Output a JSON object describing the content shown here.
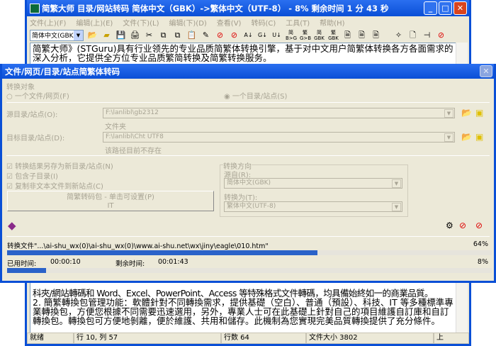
{
  "main": {
    "title": "简繁大师 目录/网站转码 简体中文（GBK）->繁体中文（UTF-8） - 8% 剩余时间 1 分 43 秒",
    "menu": [
      "文件(上)(F)",
      "编辑(上)(E)",
      "文件(下)(L)",
      "编辑(下)(D)",
      "查看(V)",
      "转码(C)",
      "工具(T)",
      "帮助(H)"
    ],
    "encoding_select": "简体中文(GBK)",
    "toolbar_labels": [
      "简B>G",
      "繁G>B",
      "简GBK",
      "繁GBK"
    ],
    "text_top": "简繁大师》(STGuru)具有行业领先的专业品质简繁体转换引擎，基于对中文用户简繁体转换各方各面需求的深入分析，它提供全方位专业品质繁简转换及简繁转换服务。",
    "text_bottom": [
      "科夾/網站轉碼和 Word、Excel、PowerPoint、Access 等特殊格式文件轉碼，均具備始終如一的商業品質。",
      "2. 簡繁轉換包管理功能：軟體針對不同轉換需求，提供基礎（空白）、普通（預設）、科技、IT 等多種標準專業轉換包，方便您根據不同需要迅速選用，另外，專業人士可在此基礎上針對自己的項目維護自訂庫和自訂轉換包。轉換包可方便地剝離，便於維護、共用和儲存。此機制為您實現完美品質轉換提供了充分條件。"
    ],
    "status": {
      "state": "就绪",
      "position": "行 10, 列 57",
      "lines": "行数 64",
      "size": "文件大小 3802",
      "dir": "上"
    }
  },
  "dialog": {
    "title": "文件/网页/目录/站点简繁体转码",
    "target_label": "转换对象",
    "radio_file": "一个文件/网页(F)",
    "radio_dir": "一个目录/站点(S)",
    "source_label": "源目录/站点(O):",
    "source_value": "F:\\lanlibl\\gb2312",
    "source_hint": "文件夹",
    "dest_label": "目标目录/站点(D):",
    "dest_value": "F:\\lanlibl\\Cht UTF8",
    "dest_hint": "该路径目前不存在",
    "checks": [
      "转换结果另存为新目录/站点(N)",
      "包含子目录(I)",
      "复制非文本文件到新站点(C)"
    ],
    "package_button": "简繁转码包 - 单击可设置(P)",
    "package_name": "IT",
    "direction_group": "转换方向",
    "src_enc_label": "源自(R):",
    "src_enc": "简体中文(GBK)",
    "dst_enc_label": "转换为(T):",
    "dst_enc": "繁体中文(UTF-8)",
    "file_progress_text": "转换文件\"...\\ai-shu_wx(0)\\ai-shu_wx(0)\\www.ai-shu.net\\wx\\jiny\\eagle\\010.htm\"",
    "file_progress_pct": "64%",
    "file_progress": 64,
    "elapsed_label": "已用时间:",
    "elapsed": "00:00:10",
    "remaining_label": "剩余时间:",
    "remaining": "00:01:43",
    "total_pct": "8%",
    "total_progress": 8
  }
}
